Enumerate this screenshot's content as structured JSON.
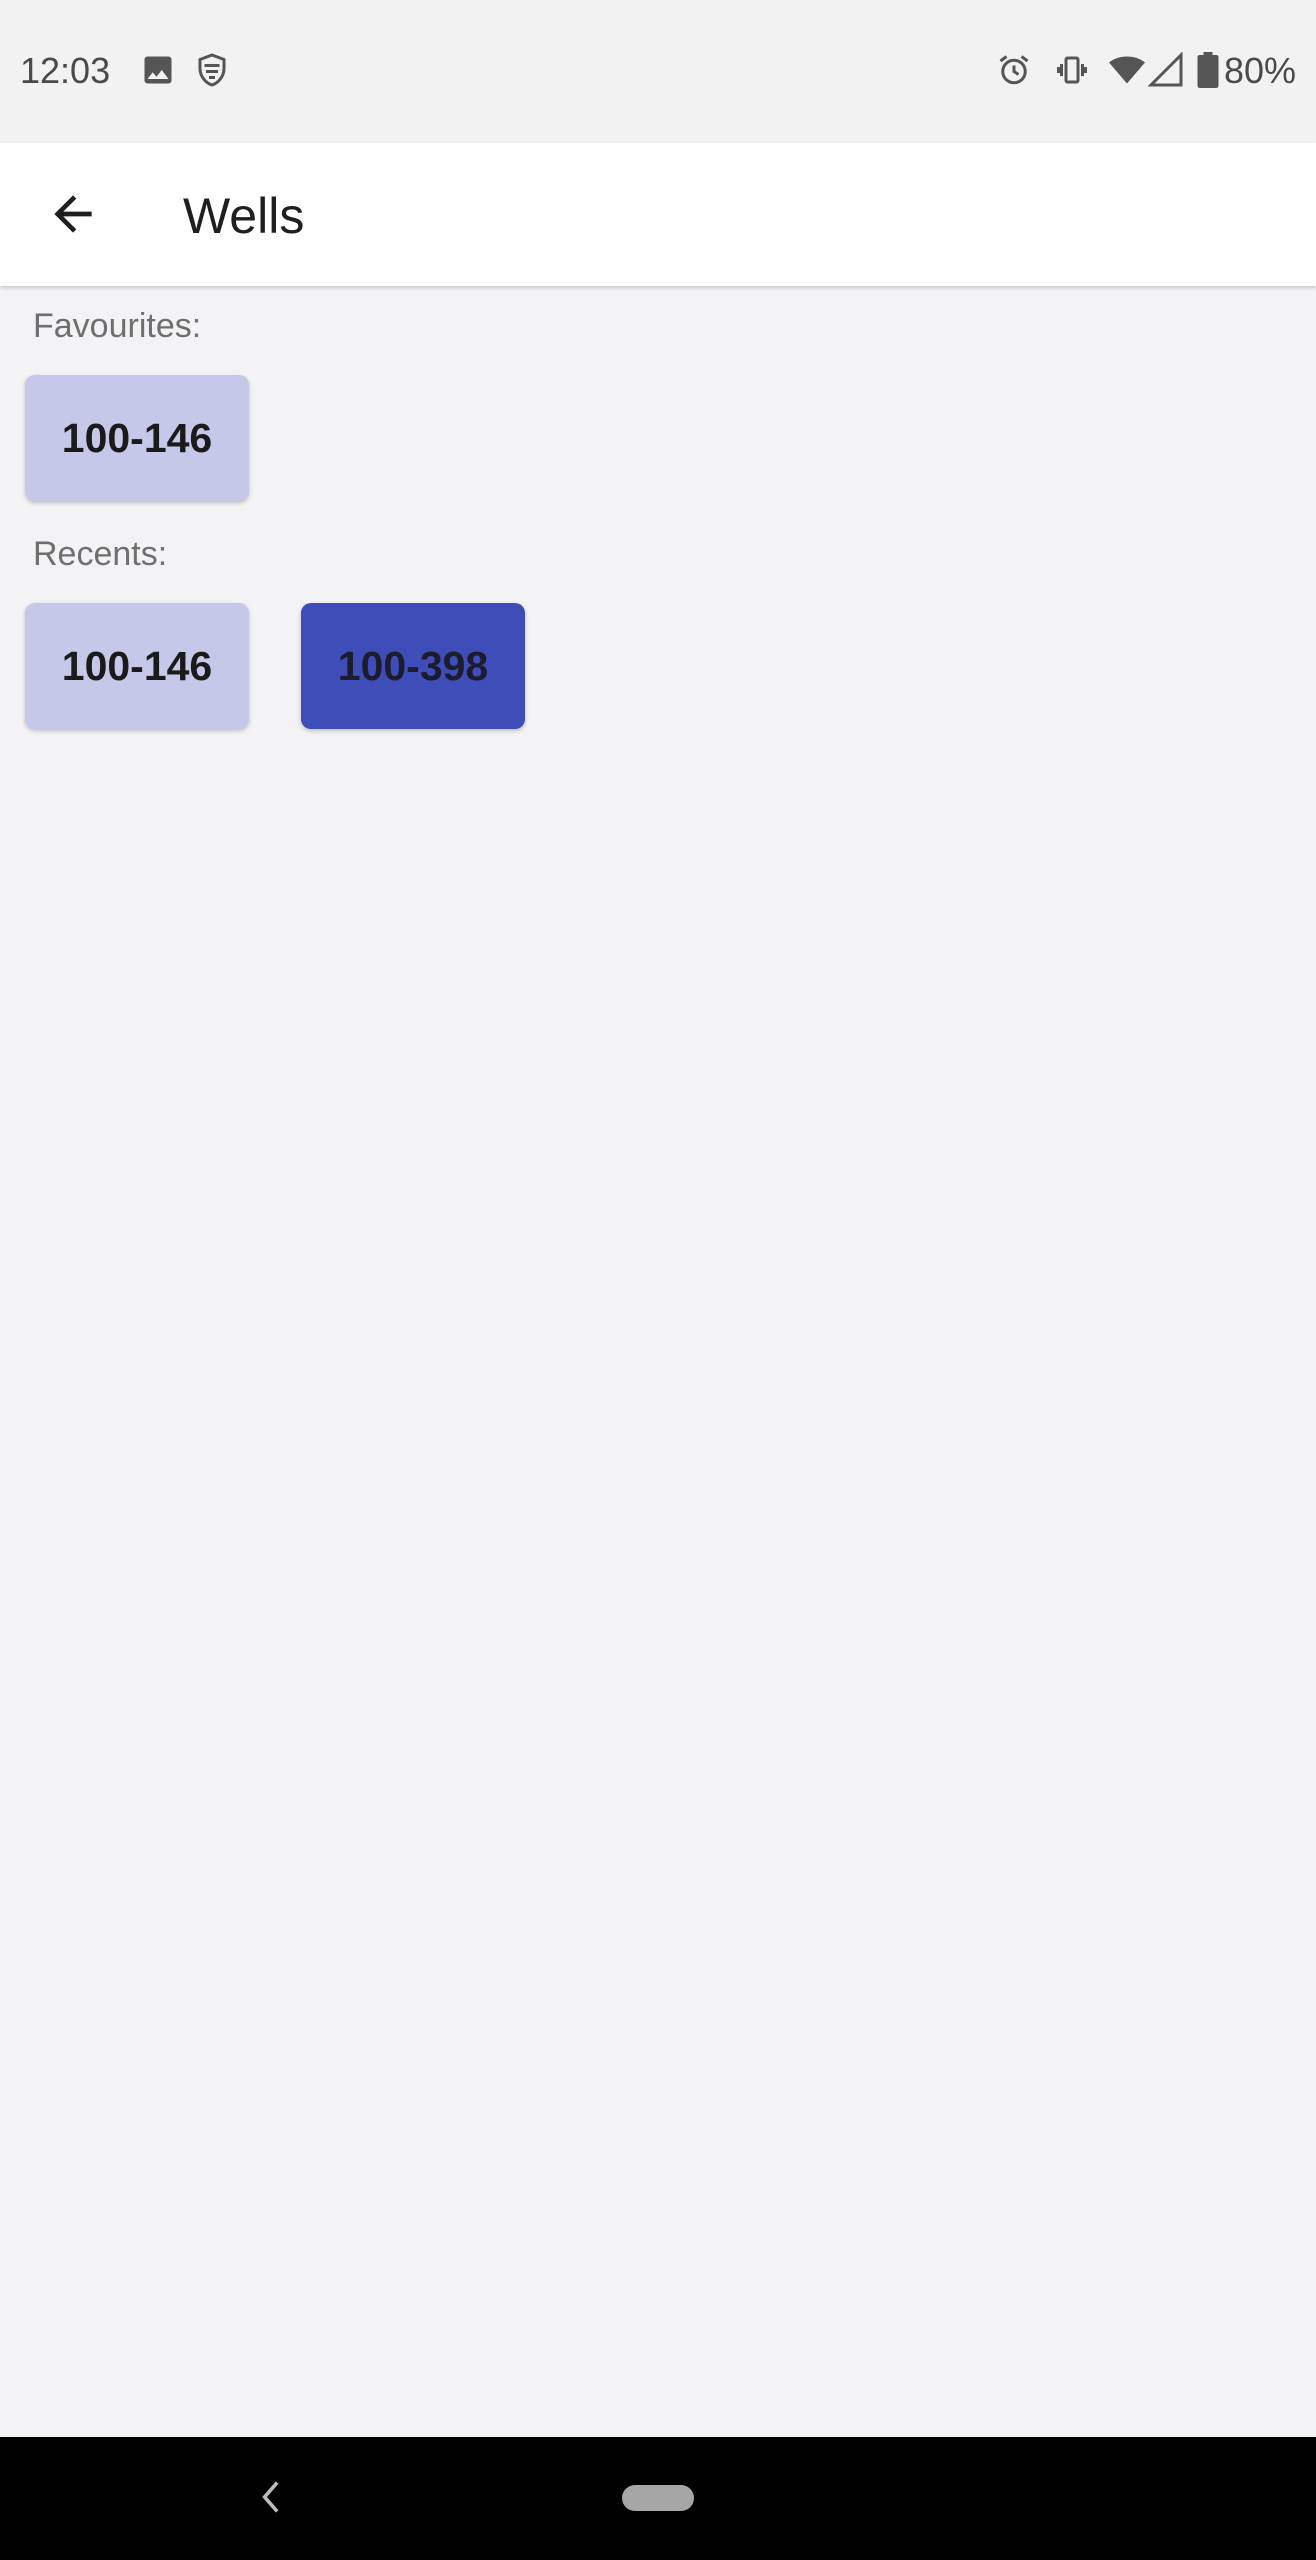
{
  "status_bar": {
    "time": "12:03",
    "battery_percent": "80%",
    "icons": [
      "image-icon",
      "shield-icon",
      "alarm-icon",
      "vibrate-icon",
      "wifi-icon",
      "cell-signal-icon",
      "battery-icon"
    ]
  },
  "app_bar": {
    "title": "Wells",
    "back_icon": "arrow-back-icon"
  },
  "favourites": {
    "label": "Favourites:",
    "items": [
      {
        "label": "100-146",
        "style": "light"
      }
    ]
  },
  "recents": {
    "label": "Recents:",
    "items": [
      {
        "label": "100-146",
        "style": "light"
      },
      {
        "label": "100-398",
        "style": "dark"
      }
    ]
  },
  "colors": {
    "chip_light": "#c5c8e8",
    "chip_dark": "#3f4db8",
    "background": "#f3f3f6",
    "app_bar": "#ffffff"
  },
  "nav_bar": {
    "icons": [
      "nav-back-icon",
      "home-pill-icon"
    ]
  }
}
